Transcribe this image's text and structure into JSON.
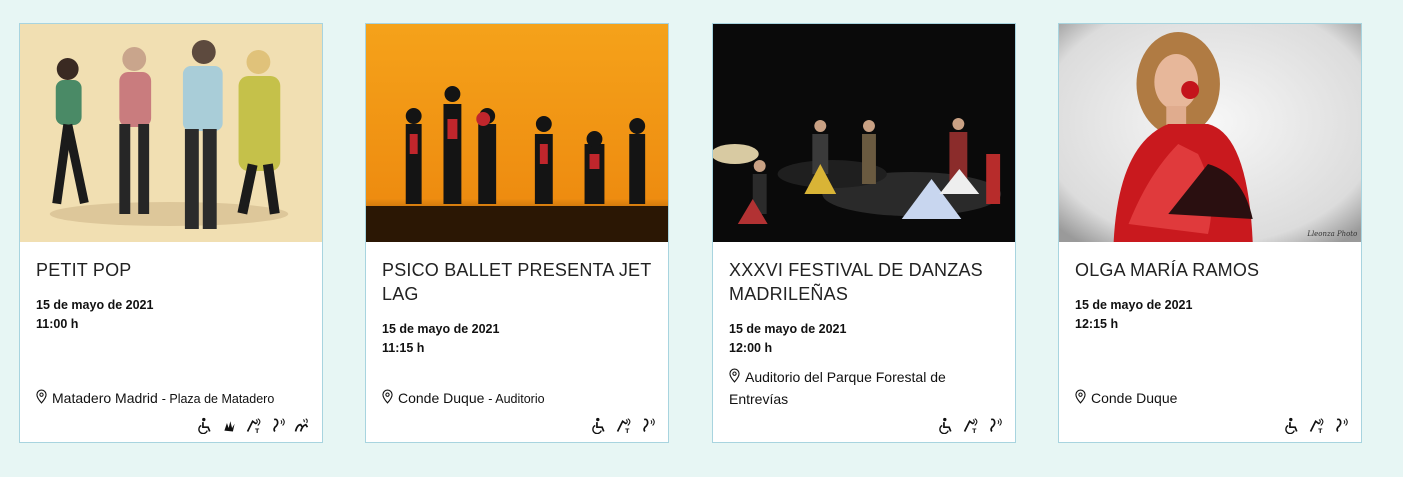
{
  "events": [
    {
      "title": "PETIT POP",
      "date": "15 de mayo de 2021",
      "time": "11:00 h",
      "venue": "Matadero Madrid",
      "venue_sub": "- Plaza de Matadero",
      "accessibility": [
        "wheelchair-icon",
        "sign-language-icon",
        "audio-description-icon",
        "hearing-loop-icon",
        "sign-language-hands-icon"
      ]
    },
    {
      "title": "PSICO BALLET PRESENTA JET LAG",
      "date": "15 de mayo de 2021",
      "time": "11:15 h",
      "venue": "Conde Duque",
      "venue_sub": "- Auditorio",
      "accessibility": [
        "wheelchair-icon",
        "audio-description-icon",
        "hearing-loop-icon"
      ]
    },
    {
      "title": "XXXVI FESTIVAL DE DANZAS MADRILEÑAS",
      "date": "15 de mayo de 2021",
      "time": "12:00 h",
      "venue": "Auditorio del Parque Forestal de Entrevías",
      "venue_sub": "",
      "accessibility": [
        "wheelchair-icon",
        "audio-description-icon",
        "hearing-loop-icon"
      ]
    },
    {
      "title": "OLGA MARÍA RAMOS",
      "date": "15 de mayo de 2021",
      "time": "12:15 h",
      "venue": "Conde Duque",
      "venue_sub": "",
      "photo_credit": "Lleonza Photo",
      "accessibility": [
        "wheelchair-icon",
        "audio-description-icon",
        "hearing-loop-icon"
      ]
    }
  ],
  "colors": {
    "page_bg": "#e7f6f4",
    "card_border": "#a8d4df",
    "img1_bg": "#f1dfb2",
    "img2_bg": "#f39a15",
    "img3_bg": "#0a0a0a",
    "img4_bg": "#dcdcdc"
  }
}
